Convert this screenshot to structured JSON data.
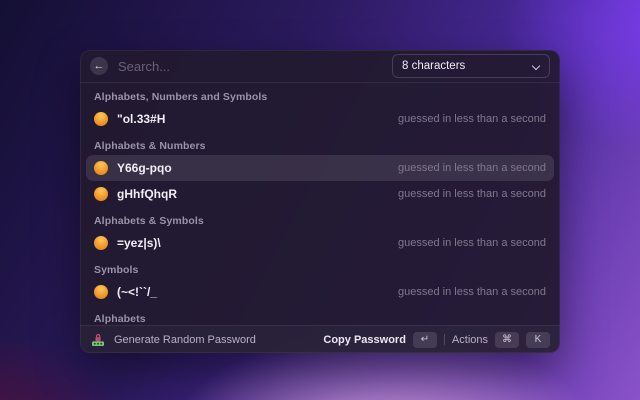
{
  "window": {
    "header": {
      "back_glyph": "←",
      "search_placeholder": "Search...",
      "dropdown_value": "8 characters"
    },
    "sections": [
      {
        "label": "Alphabets, Numbers and Symbols",
        "items": [
          {
            "password": "\"ol.33#H",
            "meta": "guessed in less than a second"
          }
        ]
      },
      {
        "label": "Alphabets & Numbers",
        "items": [
          {
            "password": "Y66g-pqo",
            "meta": "guessed in less than a second"
          },
          {
            "password": "gHhfQhqR",
            "meta": "guessed in less than a second"
          }
        ]
      },
      {
        "label": "Alphabets & Symbols",
        "items": [
          {
            "password": "=yez|s)\\",
            "meta": "guessed in less than a second"
          }
        ]
      },
      {
        "label": "Symbols",
        "items": [
          {
            "password": "(~<!``/_",
            "meta": "guessed in less than a second"
          }
        ]
      },
      {
        "label": "Alphabets",
        "items": []
      }
    ],
    "footer": {
      "command_title": "Generate Random Password",
      "primary_action": "Copy Password",
      "primary_key": "↵",
      "actions_label": "Actions",
      "action_key_1": "⌘",
      "action_key_2": "K"
    }
  },
  "colors": {
    "accent_orange": "#f5a032",
    "selection_highlight": "rgba(255,255,255,0.10)",
    "window_background": "#221a30"
  }
}
